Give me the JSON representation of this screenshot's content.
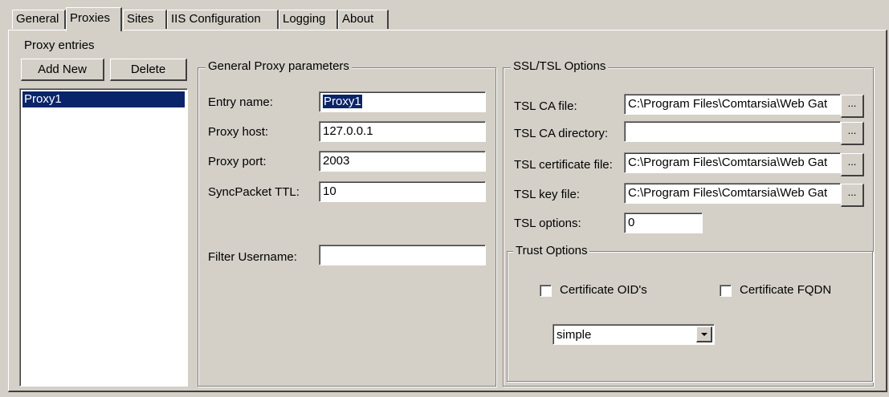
{
  "tabs": [
    {
      "label": "General"
    },
    {
      "label": "Proxies"
    },
    {
      "label": "Sites"
    },
    {
      "label": "IIS Configuration"
    },
    {
      "label": "Logging"
    },
    {
      "label": "About"
    }
  ],
  "active_tab": "Proxies",
  "proxy_entries": {
    "title": "Proxy entries",
    "add_label": "Add New",
    "delete_label": "Delete",
    "items": [
      "Proxy1"
    ],
    "selected": "Proxy1"
  },
  "general": {
    "title": "General Proxy parameters",
    "entry_name_label": "Entry name:",
    "entry_name_value": "Proxy1",
    "host_label": "Proxy host:",
    "host_value": "127.0.0.1",
    "port_label": "Proxy port:",
    "port_value": "2003",
    "ttl_label": "SyncPacket TTL:",
    "ttl_value": "10",
    "filter_label": "Filter Username:",
    "filter_value": ""
  },
  "ssl": {
    "title": "SSL/TSL Options",
    "ca_file_label": "TSL CA file:",
    "ca_file_value": "C:\\Program Files\\Comtarsia\\Web Gat",
    "ca_dir_label": "TSL CA directory:",
    "ca_dir_value": "",
    "cert_file_label": "TSL certificate file:",
    "cert_file_value": "C:\\Program Files\\Comtarsia\\Web Gat",
    "key_file_label": "TSL key file:",
    "key_file_value": "C:\\Program Files\\Comtarsia\\Web Gat",
    "options_label": "TSL options:",
    "options_value": "0",
    "browse_label": "...",
    "trust": {
      "title": "Trust Options",
      "oid_label": "Certificate OID's",
      "oid_checked": false,
      "fqdn_label": "Certificate FQDN",
      "fqdn_checked": false,
      "mode_value": "simple"
    }
  }
}
